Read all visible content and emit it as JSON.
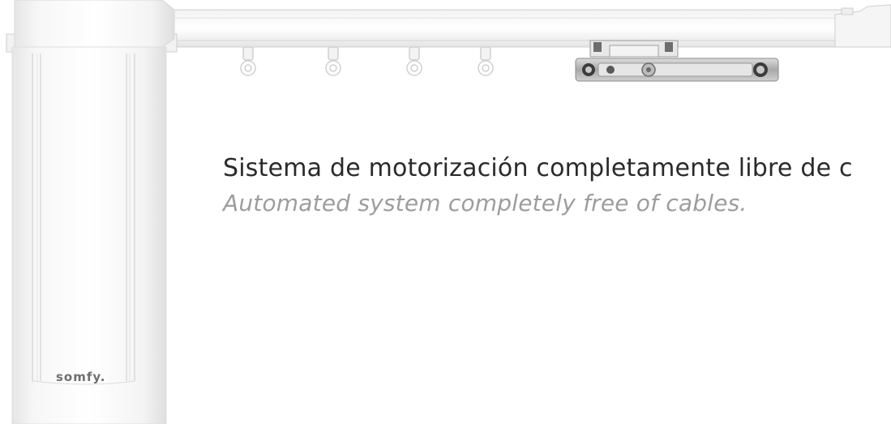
{
  "headline": "Sistema de motorización completamente libre de c",
  "subheadline": "Automated system completely free of cables.",
  "brand": {
    "logo_text": "somfy."
  },
  "colors": {
    "background": "#ffffff",
    "headline": "#2a2a2a",
    "subheadline": "#9d9d9d"
  }
}
